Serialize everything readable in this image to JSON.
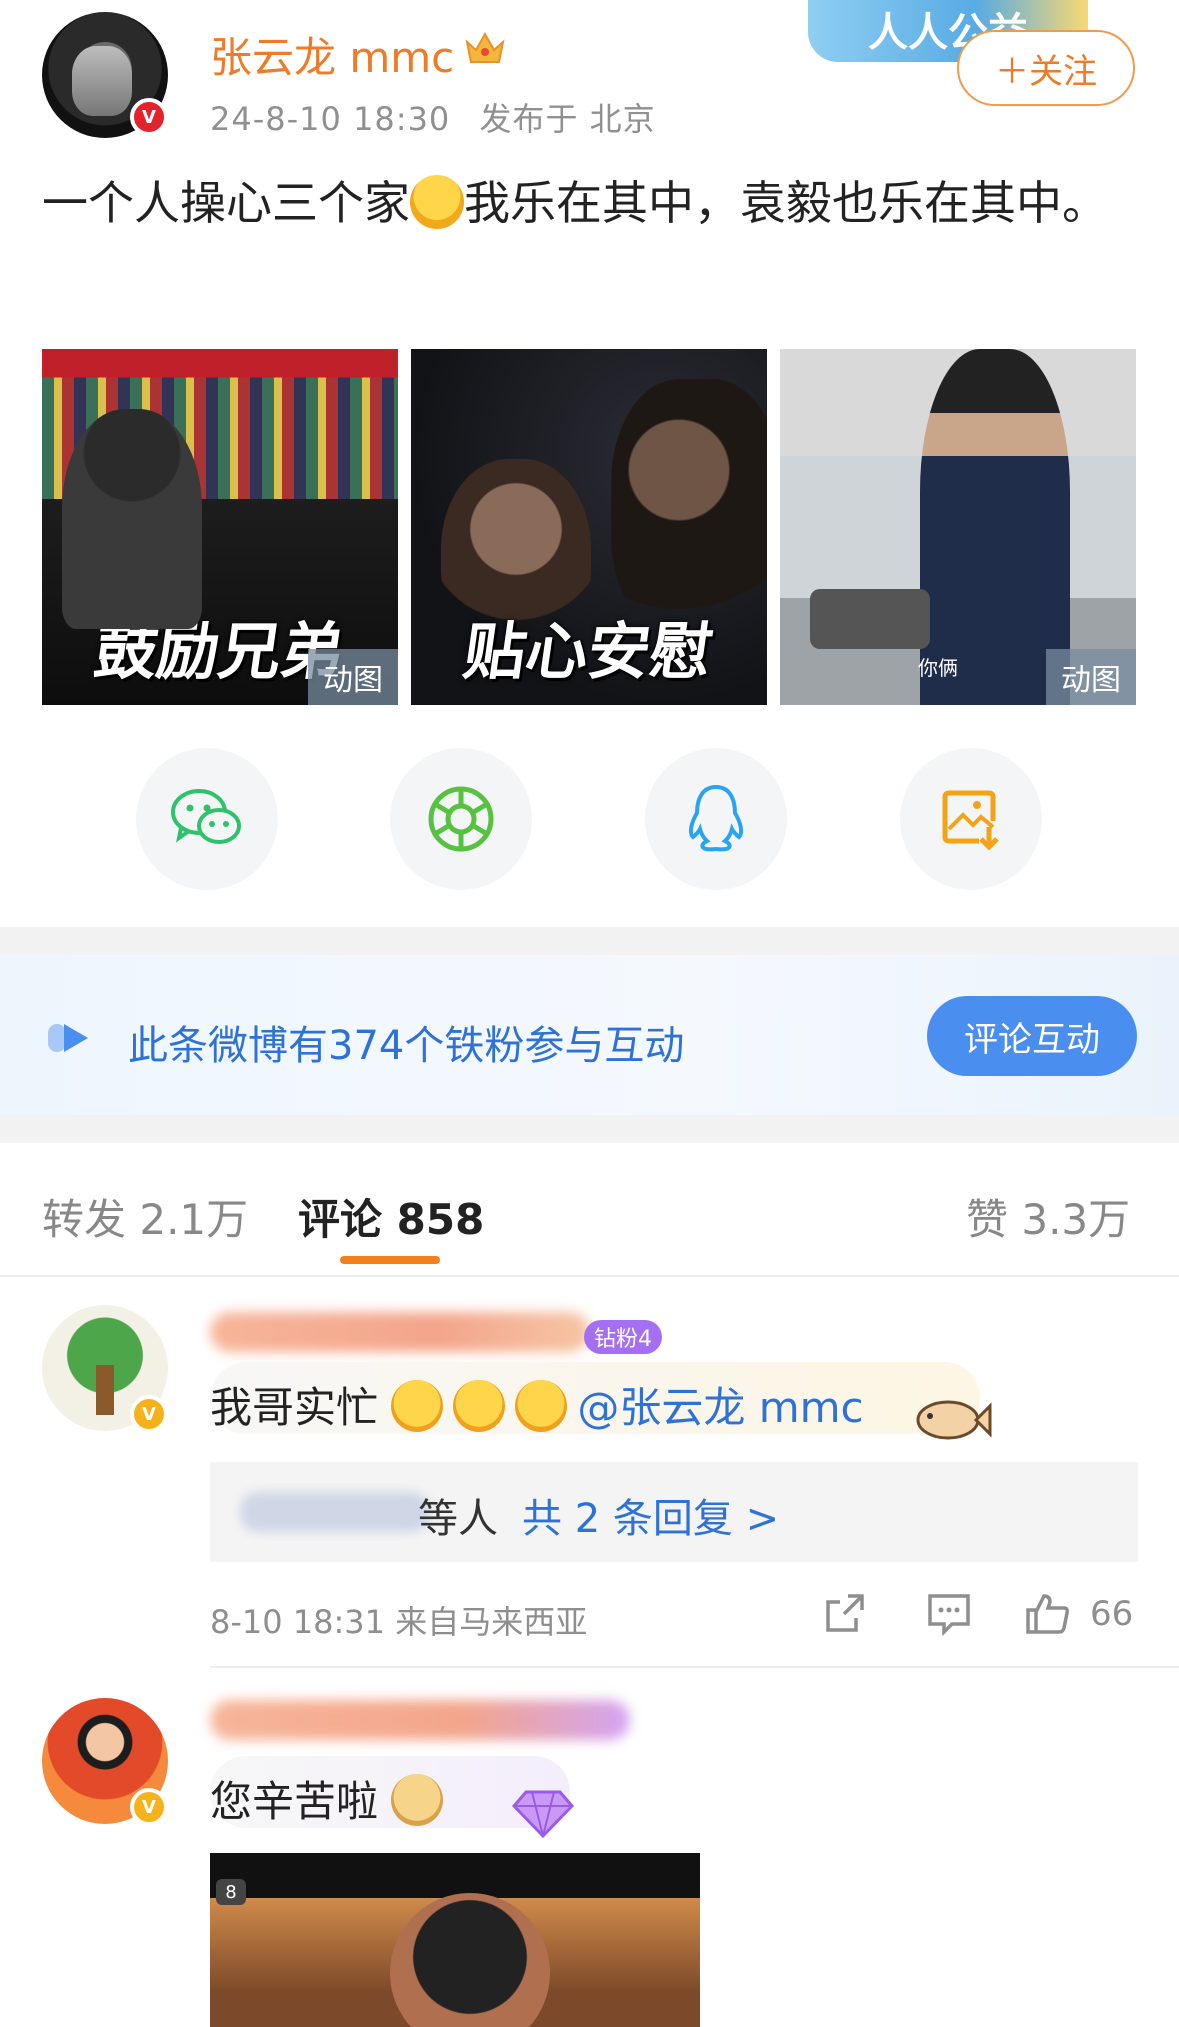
{
  "post": {
    "username": "张云龙 mmc",
    "datetime": "24-8-10 18:30",
    "location": "发布于 北京",
    "follow_label": "＋关注",
    "banner_text": "人人公益",
    "text_part1": "一个人操心三个家",
    "text_part2": "我乐在其中，袁毅也乐在其中。",
    "images": [
      {
        "caption": "鼓励兄弟",
        "badge": "动图"
      },
      {
        "caption": "贴心安慰",
        "badge": ""
      },
      {
        "caption": "你俩",
        "badge": "动图"
      }
    ]
  },
  "share": {
    "icons": [
      "wechat-icon",
      "moments-icon",
      "qq-icon",
      "save-image-icon"
    ]
  },
  "fans_bar": {
    "text": "此条微博有374个铁粉参与互动",
    "button": "评论互动"
  },
  "tabs": {
    "repost": "转发 2.1万",
    "comments": "评论 858",
    "likes": "赞 3.3万"
  },
  "comments": [
    {
      "fan_badge": "钻粉4",
      "text": "我哥实忙",
      "mention": "@张云龙 mmc",
      "reply_suffix": "等人",
      "reply_count": "共 2 条回复 >",
      "meta": "8-10 18:31 来自马来西亚",
      "likes": "66"
    },
    {
      "text": "您辛苦啦",
      "image_badge": "8"
    }
  ],
  "colors": {
    "accent_orange": "#ef7b29",
    "link_blue": "#2f72d6",
    "fans_button": "#4a8ef0"
  }
}
